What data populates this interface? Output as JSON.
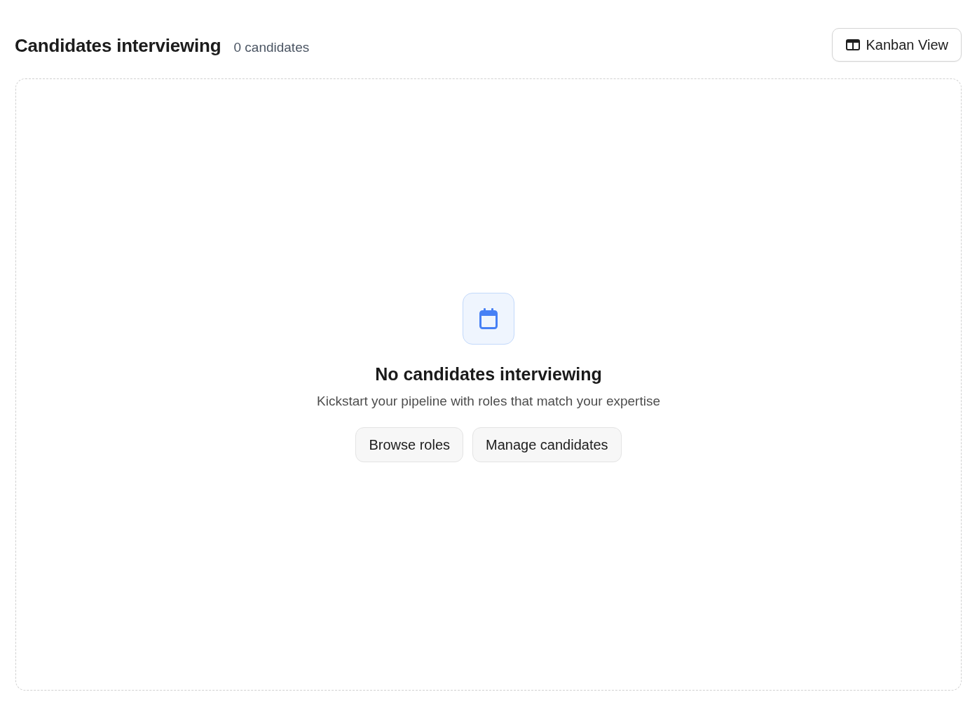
{
  "header": {
    "title": "Candidates interviewing",
    "count": "0 candidates",
    "view_button": {
      "label": "Kanban View"
    }
  },
  "empty_state": {
    "title": "No candidates interviewing",
    "message": "Kickstart your pipeline with roles that match your expertise",
    "actions": [
      {
        "label": "Browse roles"
      },
      {
        "label": "Manage candidates"
      }
    ]
  }
}
